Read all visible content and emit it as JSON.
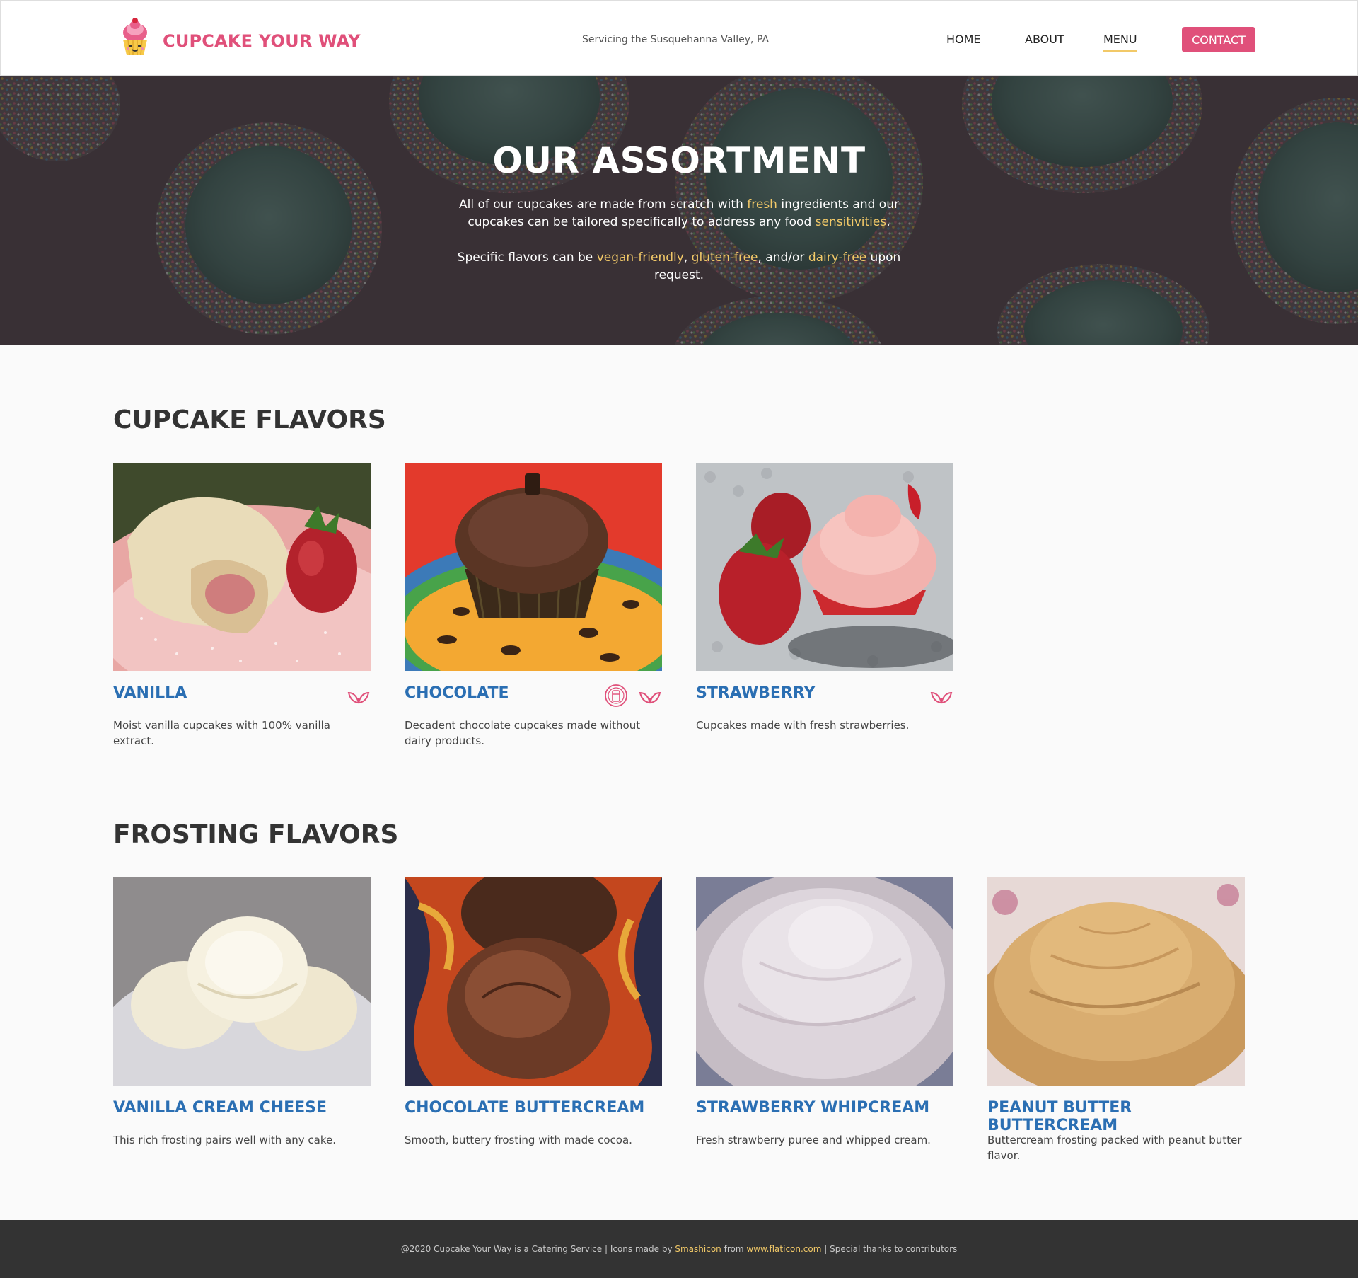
{
  "header": {
    "brand": "CUPCAKE YOUR WAY",
    "tagline": "Servicing the Susquehanna Valley, PA",
    "nav": {
      "home": "HOME",
      "about": "ABOUT",
      "menu": "MENU",
      "contact": "CONTACT"
    },
    "active_nav": "MENU",
    "brand_color": "#e0507a",
    "accent_color": "#f2c968"
  },
  "hero": {
    "title": "OUR ASSORTMENT",
    "p1": {
      "a": "All of our cupcakes are made from scratch with ",
      "b": "fresh",
      "c": " ingredients and our cupcakes can be tailored specifically to address any food ",
      "d": "sensitivities",
      "e": "."
    },
    "p2": {
      "a": "Specific flavors can be ",
      "b": "vegan-friendly",
      "c": ", ",
      "d": "gluten-free",
      "e": ", and/or ",
      "f": "dairy-free",
      "g": " upon request."
    }
  },
  "cupcakes": {
    "title": "CUPCAKE FLAVORS",
    "items": [
      {
        "name": "VANILLA",
        "desc": "Moist vanilla cupcakes with 100% vanilla extract.",
        "icons": [
          "vegan-leaf-icon"
        ]
      },
      {
        "name": "CHOCOLATE",
        "desc": "Decadent chocolate cupcakes made without dairy products.",
        "icons": [
          "dairy-free-icon",
          "vegan-leaf-icon"
        ]
      },
      {
        "name": "STRAWBERRY",
        "desc": "Cupcakes made with fresh strawberries.",
        "icons": [
          "vegan-leaf-icon"
        ]
      }
    ]
  },
  "frostings": {
    "title": "FROSTING FLAVORS",
    "items": [
      {
        "name": "VANILLA CREAM CHEESE",
        "desc": "This rich frosting pairs well with any cake."
      },
      {
        "name": "CHOCOLATE BUTTERCREAM",
        "desc": "Smooth, buttery frosting with made  cocoa."
      },
      {
        "name": "STRAWBERRY WHIPCREAM",
        "desc": "Fresh strawberry puree and whipped cream."
      },
      {
        "name": "PEANUT BUTTER BUTTERCREAM",
        "desc": "Buttercream frosting packed with peanut butter flavor."
      }
    ]
  },
  "footer": {
    "a": "@2020 Cupcake Your Way is a Catering Service | Icons made by ",
    "smashicon": "Smashicon",
    "b": " from ",
    "flaticon": "www.flaticon.com",
    "c": " | Special thanks to contributors"
  }
}
